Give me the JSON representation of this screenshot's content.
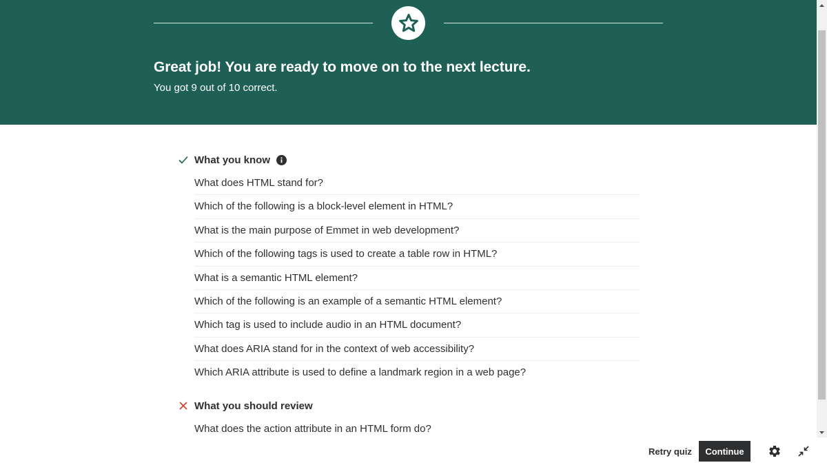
{
  "banner": {
    "title": "Great job! You are ready to move on to the next lecture.",
    "subtitle": "You got 9 out of 10 correct.",
    "badge_icon": "star-icon",
    "background_color": "#1e6055"
  },
  "know_section": {
    "heading": "What you know",
    "status_icon": "check-icon",
    "status_color": "#1e6055",
    "info_icon": "info-icon",
    "questions": [
      "What does HTML stand for?",
      "Which of the following is a block-level element in HTML?",
      "What is the main purpose of Emmet in web development?",
      "Which of the following tags is used to create a table row in HTML?",
      "What is a semantic HTML element?",
      "Which of the following is an example of a semantic HTML element?",
      "Which tag is used to include audio in an HTML document?",
      "What does ARIA stand for in the context of web accessibility?",
      "Which ARIA attribute is used to define a landmark region in a web page?"
    ]
  },
  "review_section": {
    "heading": "What you should review",
    "status_icon": "x-icon",
    "status_color": "#c4422f",
    "questions": [
      "What does the action attribute in an HTML form do?"
    ]
  },
  "footer": {
    "retry_label": "Retry quiz",
    "continue_label": "Continue",
    "settings_icon": "gear-icon",
    "collapse_icon": "collapse-icon"
  }
}
